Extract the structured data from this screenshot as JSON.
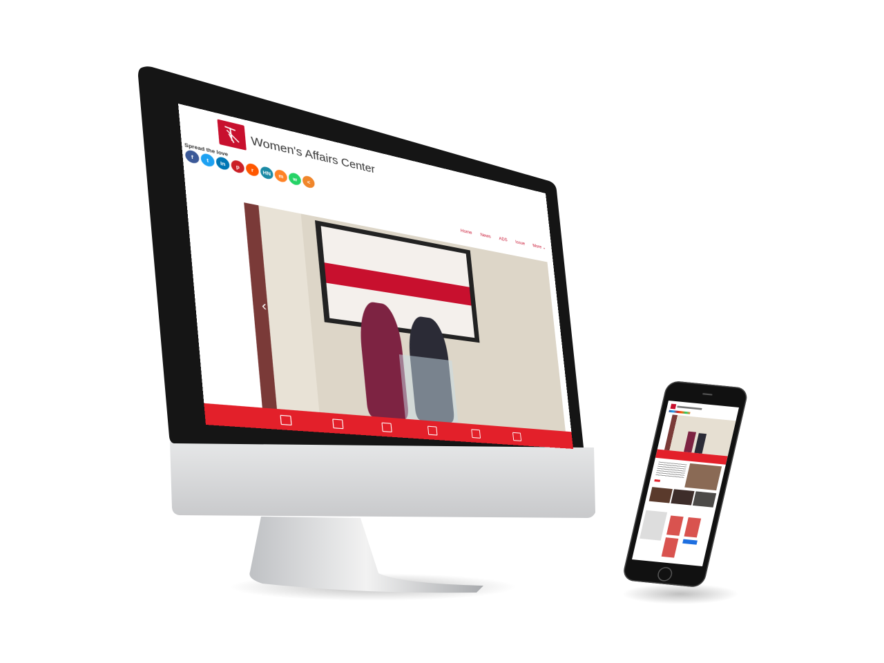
{
  "site": {
    "title": "Women's Affairs Center",
    "share_heading": "Spread the love",
    "share_buttons": [
      {
        "icon": "facebook-icon",
        "glyph": "f",
        "color": "#3b5998"
      },
      {
        "icon": "twitter-icon",
        "glyph": "t",
        "color": "#1da1f2"
      },
      {
        "icon": "linkedin-icon",
        "glyph": "in",
        "color": "#0077b5"
      },
      {
        "icon": "pinterest-icon",
        "glyph": "p",
        "color": "#cb2027"
      },
      {
        "icon": "reddit-icon",
        "glyph": "r",
        "color": "#ff5700"
      },
      {
        "icon": "hackernews-icon",
        "glyph": "HN",
        "color": "#1b8aa5"
      },
      {
        "icon": "mix-icon",
        "glyph": "m",
        "color": "#ff8226"
      },
      {
        "icon": "whatsapp-icon",
        "glyph": "w",
        "color": "#25d366"
      },
      {
        "icon": "share-icon",
        "glyph": "<",
        "color": "#f0862b"
      }
    ],
    "nav": [
      "Home",
      "News",
      "ADS",
      "Issue",
      "More ⌄"
    ],
    "brand_color": "#e3202a"
  }
}
